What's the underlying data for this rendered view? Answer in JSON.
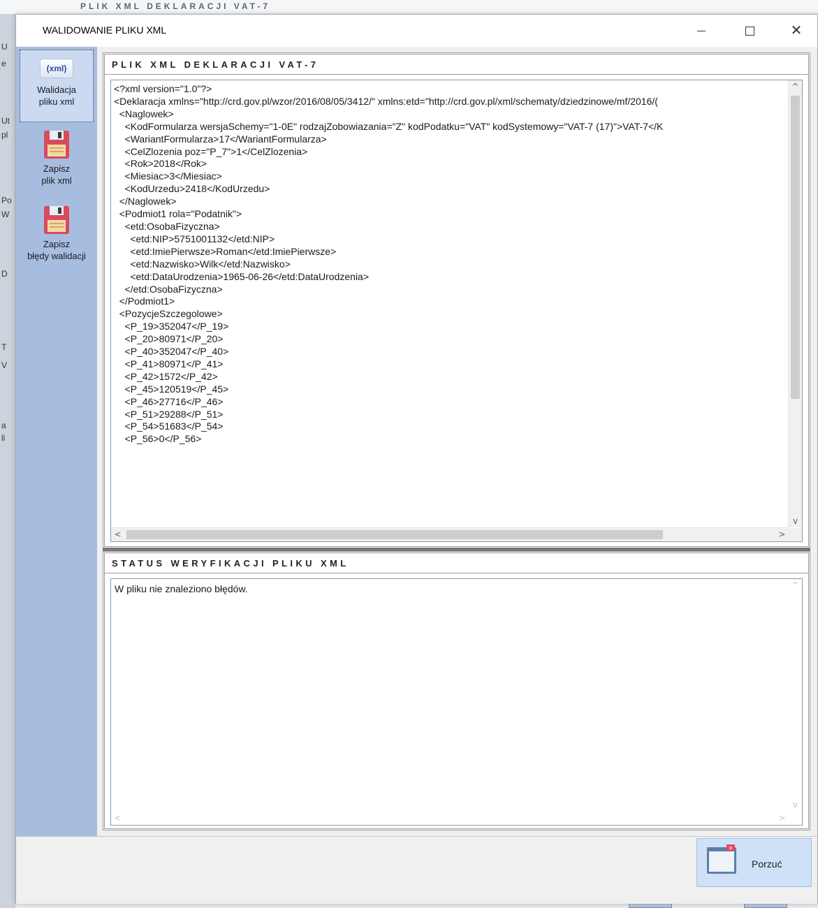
{
  "background": {
    "top_text": "PLIK XML DEKLARACJI VAT-7",
    "side_glyphs": [
      "U",
      "e",
      "Ut",
      "pl",
      "Po",
      "W",
      "D",
      "T",
      "V",
      "a",
      "li"
    ]
  },
  "window": {
    "title": "WALIDOWANIE PLIKU XML",
    "controls": {
      "minimize": "minimize-icon",
      "maximize": "maximize-icon",
      "close": "close-icon"
    }
  },
  "toolbar": {
    "items": [
      {
        "icon": "xml-icon",
        "icon_text": "(xml)",
        "label_line1": "Walidacja",
        "label_line2": "pliku xml"
      },
      {
        "icon": "floppy-disk-icon",
        "label_line1": "Zapisz",
        "label_line2": "plik xml"
      },
      {
        "icon": "floppy-disk-icon",
        "label_line1": "Zapisz",
        "label_line2": "błędy walidacji"
      }
    ]
  },
  "xml_panel": {
    "title": "PLIK XML DEKLARACJI VAT-7",
    "lines": [
      "<?xml version=\"1.0\"?>",
      "<Deklaracja xmlns=\"http://crd.gov.pl/wzor/2016/08/05/3412/\" xmlns:etd=\"http://crd.gov.pl/xml/schematy/dziedzinowe/mf/2016/(",
      "  <Naglowek>",
      "    <KodFormularza wersjaSchemy=\"1-0E\" rodzajZobowiazania=\"Z\" kodPodatku=\"VAT\" kodSystemowy=\"VAT-7 (17)\">VAT-7</K",
      "    <WariantFormularza>17</WariantFormularza>",
      "    <CelZlozenia poz=\"P_7\">1</CelZlozenia>",
      "    <Rok>2018</Rok>",
      "    <Miesiac>3</Miesiac>",
      "    <KodUrzedu>2418</KodUrzedu>",
      "  </Naglowek>",
      "  <Podmiot1 rola=\"Podatnik\">",
      "    <etd:OsobaFizyczna>",
      "      <etd:NIP>5751001132</etd:NIP>",
      "      <etd:ImiePierwsze>Roman</etd:ImiePierwsze>",
      "      <etd:Nazwisko>Wilk</etd:Nazwisko>",
      "      <etd:DataUrodzenia>1965-06-26</etd:DataUrodzenia>",
      "    </etd:OsobaFizyczna>",
      "  </Podmiot1>",
      "  <PozycjeSzczegolowe>",
      "    <P_19>352047</P_19>",
      "    <P_20>80971</P_20>",
      "    <P_40>352047</P_40>",
      "    <P_41>80971</P_41>",
      "    <P_42>1572</P_42>",
      "    <P_45>120519</P_45>",
      "    <P_46>27716</P_46>",
      "    <P_51>29288</P_51>",
      "    <P_54>51683</P_54>",
      "    <P_56>0</P_56>"
    ]
  },
  "status_panel": {
    "title": "STATUS WERYFIKACJI PLIKU XML",
    "message": "W pliku  nie znaleziono błędów."
  },
  "footer": {
    "abandon_label": "Porzuć"
  }
}
